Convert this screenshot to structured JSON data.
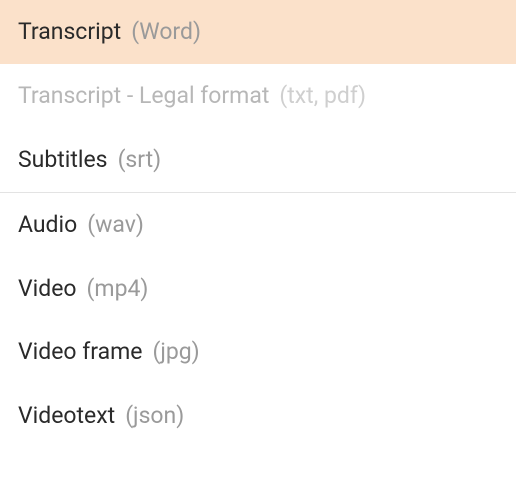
{
  "menu": {
    "items": [
      {
        "label": "Transcript",
        "format": "(Word)",
        "selected": true,
        "disabled": false
      },
      {
        "label": "Transcript - Legal format",
        "format": "(txt, pdf)",
        "selected": false,
        "disabled": true
      },
      {
        "label": "Subtitles",
        "format": "(srt)",
        "selected": false,
        "disabled": false
      }
    ],
    "items2": [
      {
        "label": "Audio",
        "format": "(wav)",
        "selected": false,
        "disabled": false
      },
      {
        "label": "Video",
        "format": "(mp4)",
        "selected": false,
        "disabled": false
      },
      {
        "label": "Video frame",
        "format": "(jpg)",
        "selected": false,
        "disabled": false
      },
      {
        "label": "Videotext",
        "format": "(json)",
        "selected": false,
        "disabled": false
      }
    ]
  }
}
